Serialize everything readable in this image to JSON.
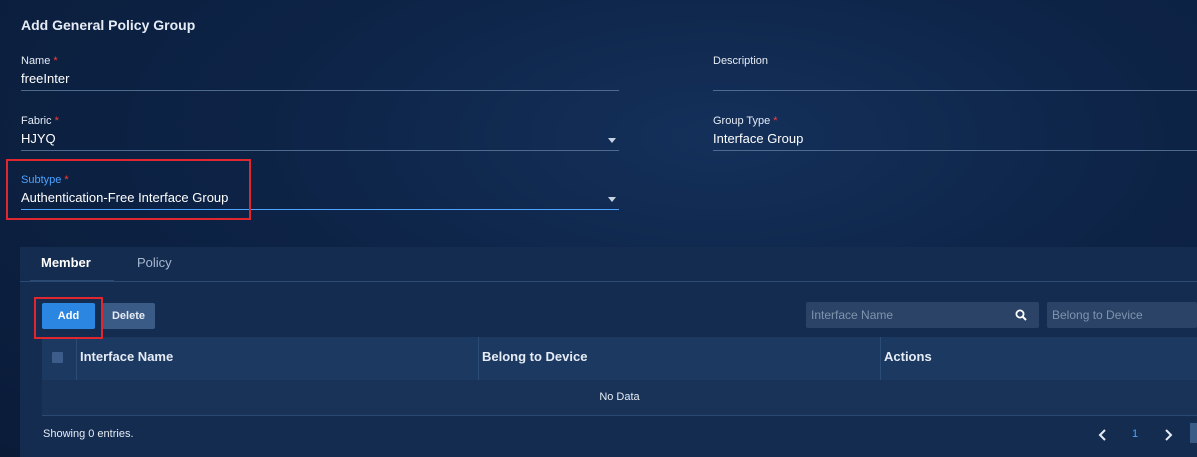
{
  "title": "Add General Policy Group",
  "form": {
    "name": {
      "label": "Name",
      "required_mark": "*",
      "value": "freeInter"
    },
    "description": {
      "label": "Description",
      "value": ""
    },
    "fabric": {
      "label": "Fabric",
      "required_mark": "*",
      "value": "HJYQ"
    },
    "group_type": {
      "label": "Group Type",
      "required_mark": "*",
      "value": "Interface Group"
    },
    "subtype": {
      "label": "Subtype",
      "required_mark": "*",
      "value": "Authentication-Free Interface Group"
    }
  },
  "tabs": [
    {
      "label": "Member",
      "active": true
    },
    {
      "label": "Policy",
      "active": false
    }
  ],
  "toolbar": {
    "add_label": "Add",
    "delete_label": "Delete"
  },
  "filters": {
    "interface_name_placeholder": "Interface Name",
    "device_placeholder": "Belong to Device"
  },
  "table": {
    "columns": [
      "Interface Name",
      "Belong to Device",
      "Actions"
    ],
    "empty_text": "No Data"
  },
  "footer": {
    "showing": "Showing 0 entries."
  },
  "pagination": {
    "prev": "‹",
    "page": "1",
    "next": "›"
  },
  "colors": {
    "accent": "#2a86e0",
    "highlight_box": "#e0262f",
    "required": "#ff3b3b"
  }
}
